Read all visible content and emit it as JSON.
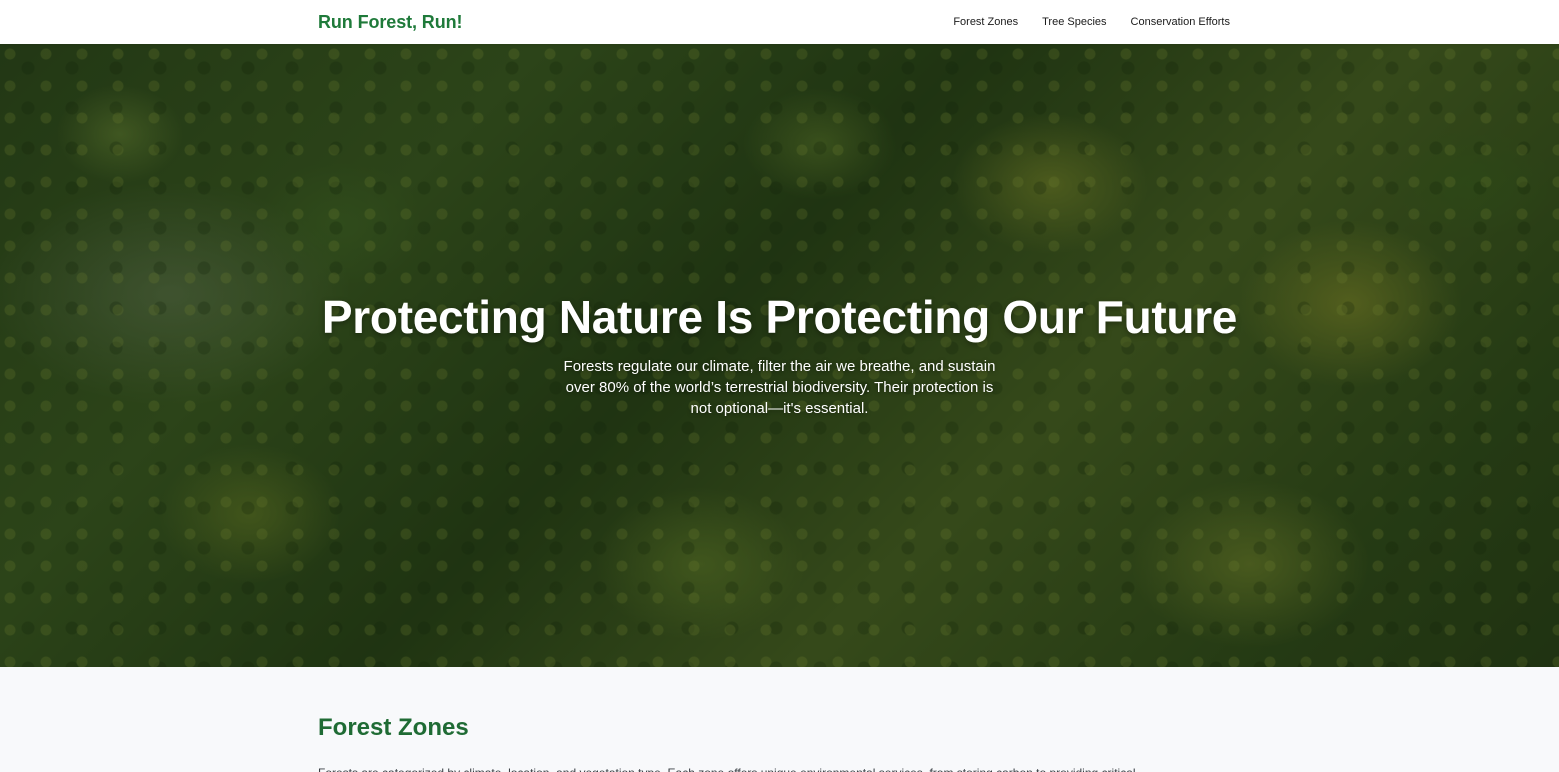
{
  "header": {
    "brand": "Run Forest, Run!",
    "nav": [
      {
        "label": "Forest Zones"
      },
      {
        "label": "Tree Species"
      },
      {
        "label": "Conservation Efforts"
      }
    ]
  },
  "hero": {
    "title": "Protecting Nature Is Protecting Our Future",
    "subtitle": "Forests regulate our climate, filter the air we breathe, and sustain over 80% of the world’s terrestrial biodiversity. Their protection is not optional—it's essential."
  },
  "forest_zones": {
    "title": "Forest Zones",
    "text": "Forests are categorized by climate, location, and vegetation type. Each zone offers unique environmental services, from storing carbon to providing critical"
  },
  "colors": {
    "brand": "#1f7a3a",
    "section_title": "#1f6b34",
    "section_background": "#f8f9fb"
  }
}
